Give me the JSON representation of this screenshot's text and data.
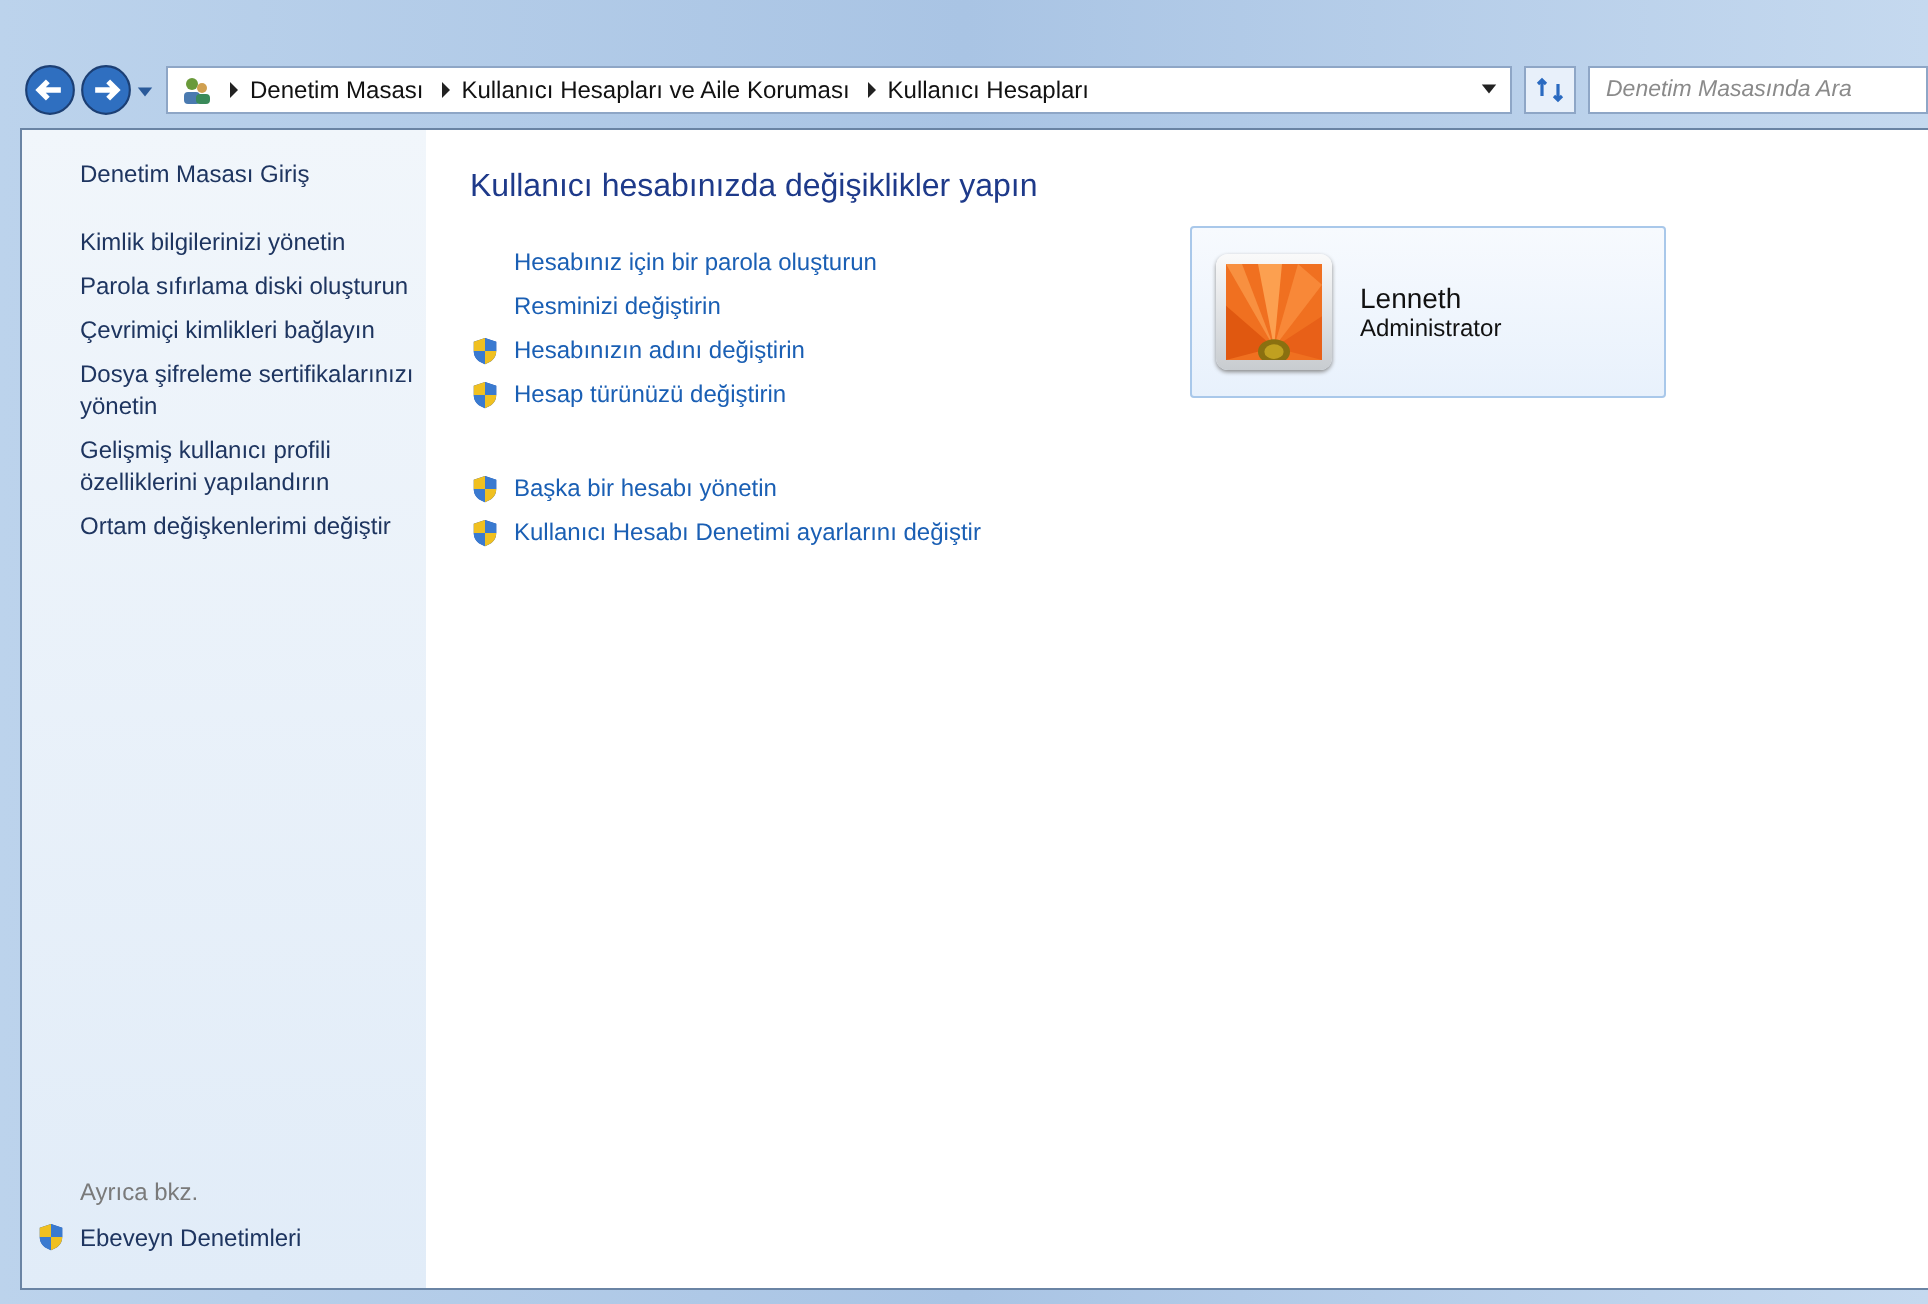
{
  "address_bar": {
    "breadcrumbs": [
      "Denetim Masası",
      "Kullanıcı Hesapları ve Aile Koruması",
      "Kullanıcı Hesapları"
    ]
  },
  "search": {
    "placeholder": "Denetim Masasında Ara"
  },
  "sidebar": {
    "home": "Denetim Masası Giriş",
    "tasks": [
      "Kimlik bilgilerinizi yönetin",
      "Parola sıfırlama diski oluşturun",
      "Çevrimiçi kimlikleri bağlayın",
      "Dosya şifreleme sertifikalarınızı yönetin",
      "Gelişmiş kullanıcı profili özelliklerini yapılandırın",
      "Ortam değişkenlerimi değiştir"
    ],
    "see_also": {
      "heading": "Ayrıca bkz.",
      "items": [
        {
          "label": "Ebeveyn Denetimleri",
          "shield": true
        }
      ]
    }
  },
  "main": {
    "title": "Kullanıcı hesabınızda değişiklikler yapın",
    "link_groups": [
      [
        {
          "label": "Hesabınız için bir parola oluşturun",
          "shield": false
        },
        {
          "label": "Resminizi değiştirin",
          "shield": false
        },
        {
          "label": "Hesabınızın adını değiştirin",
          "shield": true
        },
        {
          "label": "Hesap türünüzü değiştirin",
          "shield": true
        }
      ],
      [
        {
          "label": "Başka bir hesabı yönetin",
          "shield": true
        },
        {
          "label": "Kullanıcı Hesabı Denetimi ayarlarını değiştir",
          "shield": true
        }
      ]
    ],
    "account": {
      "name": "Lenneth",
      "role": "Administrator"
    }
  }
}
